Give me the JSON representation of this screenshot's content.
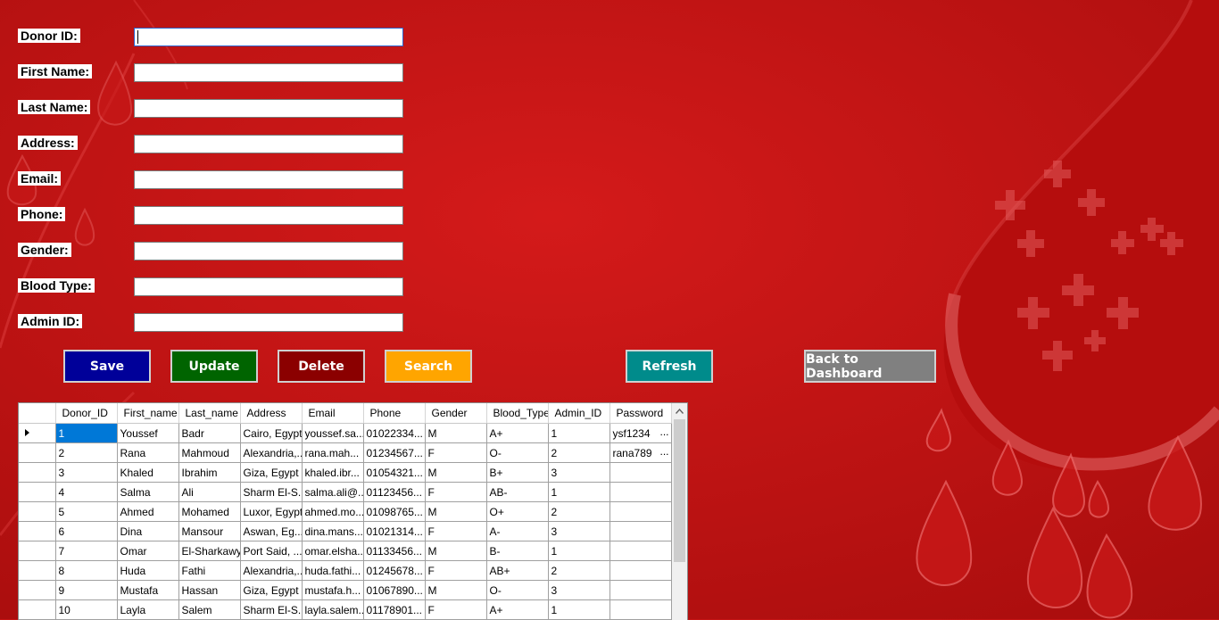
{
  "form": {
    "fields": [
      {
        "key": "donor_id",
        "label": "Donor ID:",
        "value": ""
      },
      {
        "key": "first_name",
        "label": "First Name:",
        "value": ""
      },
      {
        "key": "last_name",
        "label": "Last Name:",
        "value": ""
      },
      {
        "key": "address",
        "label": "Address:",
        "value": ""
      },
      {
        "key": "email",
        "label": "Email:",
        "value": ""
      },
      {
        "key": "phone",
        "label": "Phone:",
        "value": ""
      },
      {
        "key": "gender",
        "label": "Gender:",
        "value": ""
      },
      {
        "key": "blood_type",
        "label": "Blood Type:",
        "value": ""
      },
      {
        "key": "admin_id",
        "label": "Admin ID:",
        "value": ""
      }
    ]
  },
  "buttons": {
    "save": "Save",
    "update": "Update",
    "delete": "Delete",
    "search": "Search",
    "refresh": "Refresh",
    "back": "Back to Dashboard"
  },
  "colors": {
    "background": "#c41414",
    "save": "#000099",
    "update": "#006400",
    "delete": "#8b0000",
    "search": "#ffa500",
    "refresh": "#008b8b",
    "back": "#808080",
    "selection": "#0078d7"
  },
  "grid": {
    "columns": [
      "Donor_ID",
      "First_name",
      "Last_name",
      "Address",
      "Email",
      "Phone",
      "Gender",
      "Blood_Type",
      "Admin_ID",
      "Password"
    ],
    "rows": [
      [
        "1",
        "Youssef",
        "Badr",
        "Cairo, Egypt",
        "youssef.sa...",
        "01022334...",
        "M",
        "A+",
        "1",
        "ysf1234"
      ],
      [
        "2",
        "Rana",
        "Mahmoud",
        "Alexandria,...",
        "rana.mah...",
        "01234567...",
        "F",
        "O-",
        "2",
        "rana789"
      ],
      [
        "3",
        "Khaled",
        "Ibrahim",
        "Giza, Egypt",
        "khaled.ibr...",
        "01054321...",
        "M",
        "B+",
        "3",
        ""
      ],
      [
        "4",
        "Salma",
        "Ali",
        "Sharm El-S...",
        "salma.ali@...",
        "01123456...",
        "F",
        "AB-",
        "1",
        ""
      ],
      [
        "5",
        "Ahmed",
        "Mohamed",
        "Luxor, Egypt",
        "ahmed.mo...",
        "01098765...",
        "M",
        "O+",
        "2",
        ""
      ],
      [
        "6",
        "Dina",
        "Mansour",
        "Aswan, Eg...",
        "dina.mans...",
        "01021314...",
        "F",
        "A-",
        "3",
        ""
      ],
      [
        "7",
        "Omar",
        "El-Sharkawy",
        "Port Said, ...",
        "omar.elsha...",
        "01133456...",
        "M",
        "B-",
        "1",
        ""
      ],
      [
        "8",
        "Huda",
        "Fathi",
        "Alexandria,...",
        "huda.fathi...",
        "01245678...",
        "F",
        "AB+",
        "2",
        ""
      ],
      [
        "9",
        "Mustafa",
        "Hassan",
        "Giza, Egypt",
        "mustafa.h...",
        "01067890...",
        "M",
        "O-",
        "3",
        ""
      ],
      [
        "10",
        "Layla",
        "Salem",
        "Sharm El-S...",
        "layla.salem...",
        "01178901...",
        "F",
        "A+",
        "1",
        ""
      ]
    ],
    "truncation_marker": "...",
    "selected_row": 0,
    "selected_col": 0
  }
}
